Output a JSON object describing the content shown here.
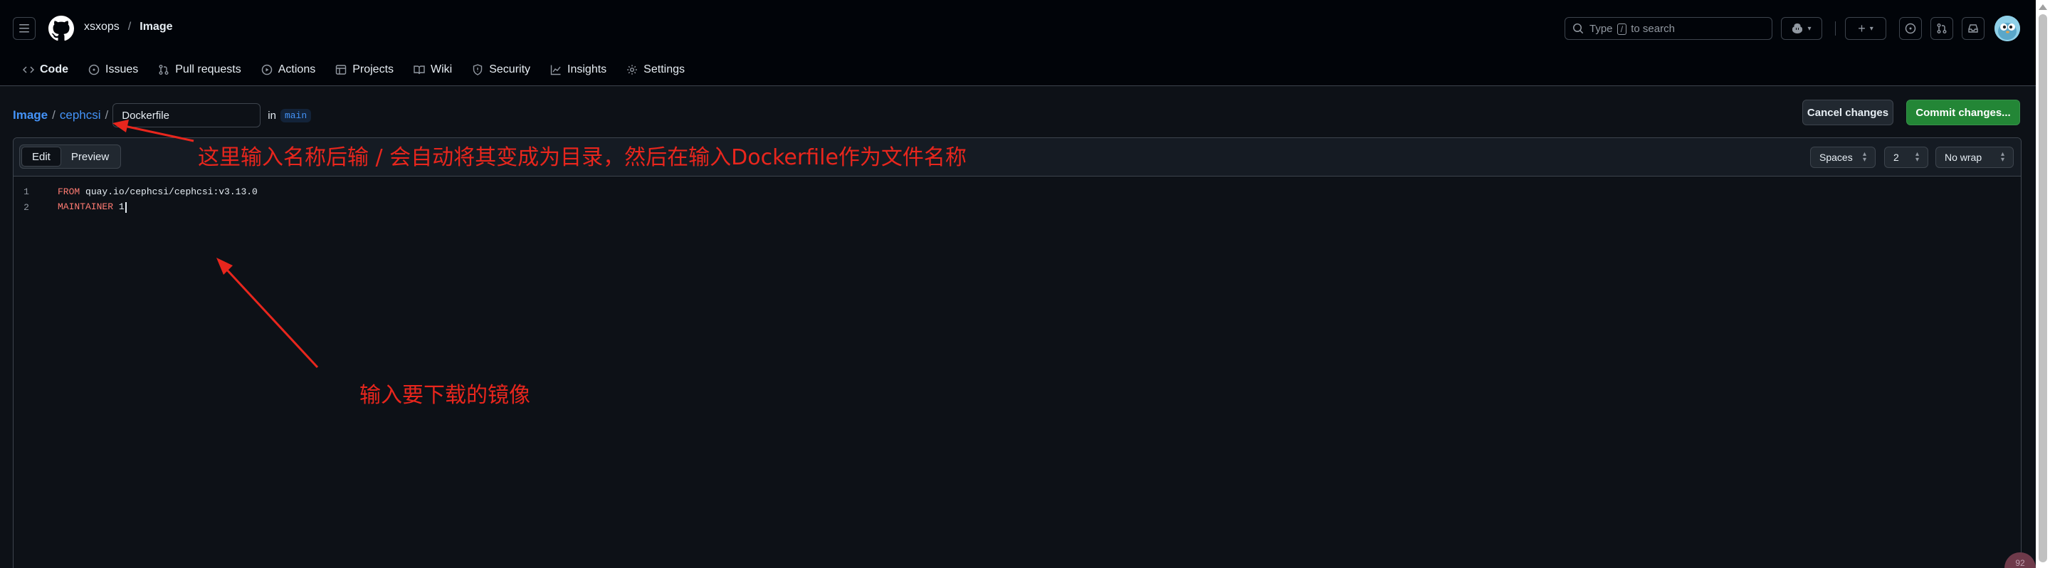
{
  "header": {
    "owner": "xsxops",
    "repo": "Image",
    "search_prefix": "Type",
    "search_key": "/",
    "search_suffix": "to search"
  },
  "tabs": [
    {
      "label": "Code",
      "active": true
    },
    {
      "label": "Issues"
    },
    {
      "label": "Pull requests"
    },
    {
      "label": "Actions"
    },
    {
      "label": "Projects"
    },
    {
      "label": "Wiki"
    },
    {
      "label": "Security"
    },
    {
      "label": "Insights"
    },
    {
      "label": "Settings"
    }
  ],
  "breadcrumb": {
    "repo": "Image",
    "folder": "cephcsi",
    "filename_value": "Dockerfile",
    "in_text": "in",
    "branch": "main"
  },
  "actions": {
    "cancel": "Cancel changes",
    "commit": "Commit changes..."
  },
  "editor": {
    "tab_edit": "Edit",
    "tab_preview": "Preview",
    "indent_mode": "Spaces",
    "indent_size": "2",
    "wrap_mode": "No wrap",
    "lines": [
      {
        "num": "1",
        "keyword": "FROM",
        "text": " quay.io/cephcsi/cephcsi:v3.13.0"
      },
      {
        "num": "2",
        "keyword": "MAINTAINER",
        "text": " 1"
      }
    ]
  },
  "annotations": {
    "top": "这里输入名称后输 /  会自动将其变成为目录，然后在输入Dockerfile作为文件名称",
    "bottom": "输入要下载的镜像",
    "color": "#e8261d"
  },
  "badge": "92"
}
